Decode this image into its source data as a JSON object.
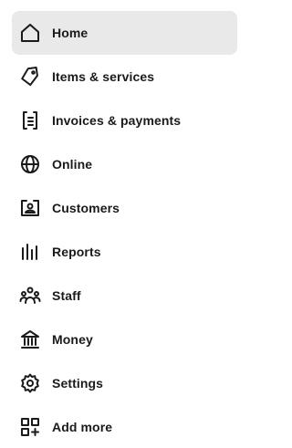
{
  "sidebar": {
    "active_index": 0,
    "items": [
      {
        "label": "Home",
        "icon": "home-icon"
      },
      {
        "label": "Items & services",
        "icon": "tag-icon"
      },
      {
        "label": "Invoices & payments",
        "icon": "invoice-icon"
      },
      {
        "label": "Online",
        "icon": "globe-icon"
      },
      {
        "label": "Customers",
        "icon": "customer-card-icon"
      },
      {
        "label": "Reports",
        "icon": "bar-chart-icon"
      },
      {
        "label": "Staff",
        "icon": "people-icon"
      },
      {
        "label": "Money",
        "icon": "bank-icon"
      },
      {
        "label": "Settings",
        "icon": "gear-icon"
      },
      {
        "label": "Add more",
        "icon": "apps-add-icon"
      }
    ]
  },
  "colors": {
    "active_background": "#e9e9e9",
    "text": "#1a1a1a",
    "background": "#ffffff"
  }
}
